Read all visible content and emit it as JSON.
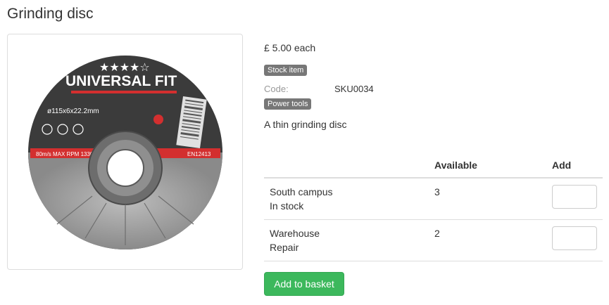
{
  "product": {
    "title": "Grinding disc",
    "price": "£ 5.00 each",
    "stock_badge": "Stock item",
    "code_label": "Code:",
    "code_value": "SKU0034",
    "category_badge": "Power tools",
    "description": "A thin grinding disc",
    "image": {
      "brand_text": "UNIVERSAL FIT",
      "size_text": "ø115x6x22.2mm",
      "speed_text": "80m/s MAX RPM 13300",
      "standard_text": "EN12413",
      "colors": {
        "disc": "#3b3b3b",
        "band": "#d32f2f",
        "abrasive": "#9e9e9e"
      }
    }
  },
  "stock_table": {
    "headers": {
      "location": "",
      "available": "Available",
      "add": "Add"
    },
    "rows": [
      {
        "location": "South campus",
        "status": "In stock",
        "available": "3",
        "quantity": ""
      },
      {
        "location": "Warehouse",
        "status": "Repair",
        "available": "2",
        "quantity": ""
      }
    ]
  },
  "actions": {
    "add_to_basket": "Add to basket",
    "button_color": "#3cb85c"
  }
}
